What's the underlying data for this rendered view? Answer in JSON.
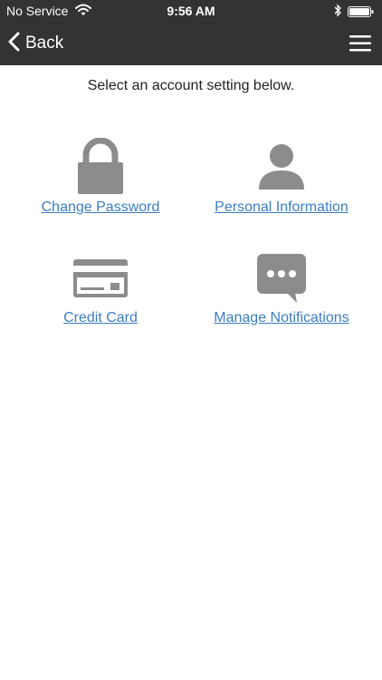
{
  "status_bar": {
    "carrier": "No Service",
    "time": "9:56 AM",
    "wifi_icon": "wifi-icon",
    "bluetooth_icon": "bluetooth-icon",
    "battery_icon": "battery-icon"
  },
  "nav": {
    "back_label": "Back",
    "back_icon": "chevron-left-icon",
    "menu_icon": "hamburger-menu-icon"
  },
  "main": {
    "instructions": "Select an account setting below.",
    "settings": [
      {
        "label": "Change Password",
        "icon": "lock-icon"
      },
      {
        "label": "Personal Information",
        "icon": "person-icon"
      },
      {
        "label": "Credit Card",
        "icon": "credit-card-icon"
      },
      {
        "label": "Manage Notifications",
        "icon": "chat-bubble-icon"
      }
    ]
  },
  "colors": {
    "bar_background": "#333333",
    "icon_gray": "#8c8c8c",
    "link_blue": "#3b7dc4",
    "page_background": "#ffffff"
  }
}
